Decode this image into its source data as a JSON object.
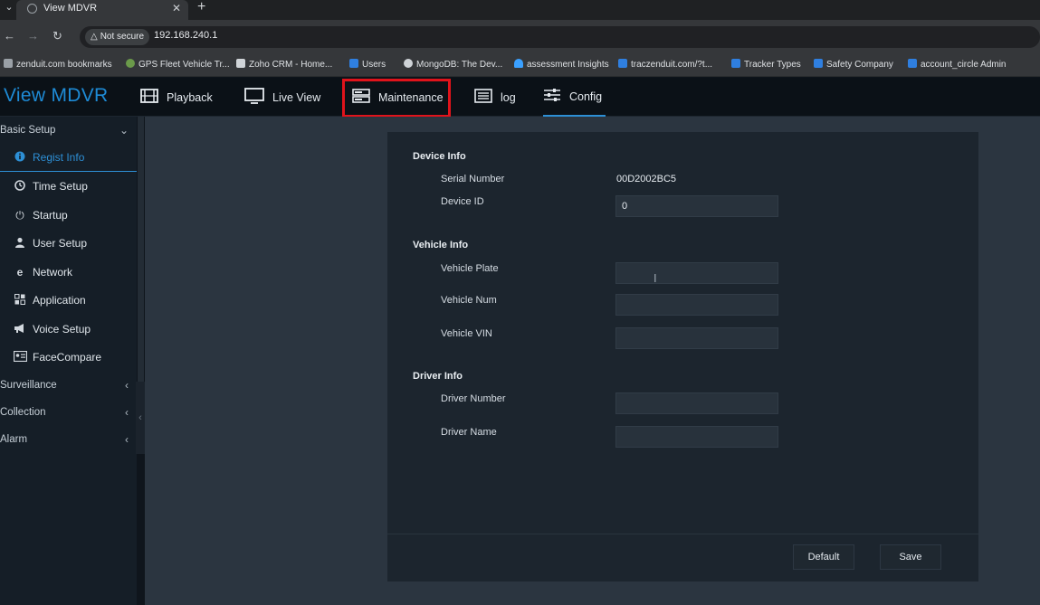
{
  "browser": {
    "tab_title": "View MDVR",
    "security_label": "Not secure",
    "url": "192.168.240.1",
    "bookmarks": [
      {
        "label": "zenduit.com bookmarks",
        "icon": "folder-icon",
        "color": "#9aa0a6"
      },
      {
        "label": "GPS Fleet Vehicle Tr...",
        "icon": "globe-icon",
        "color": "#6b9a4a"
      },
      {
        "label": "Zoho CRM - Home...",
        "icon": "zoho-icon",
        "color": "#d0d4d8"
      },
      {
        "label": "Users",
        "icon": "zenduit-icon",
        "color": "#2f7fe0"
      },
      {
        "label": "MongoDB: The Dev...",
        "icon": "mongodb-icon",
        "color": "#cfd3d7"
      },
      {
        "label": "assessment Insights",
        "icon": "cloud-icon",
        "color": "#3aa0ff"
      },
      {
        "label": "traczenduit.com/?t...",
        "icon": "zenduit-icon",
        "color": "#2f7fe0"
      },
      {
        "label": "Tracker Types",
        "icon": "zenduit-icon",
        "color": "#2f7fe0"
      },
      {
        "label": "Safety Company",
        "icon": "zenduit-icon",
        "color": "#2f7fe0"
      },
      {
        "label": "account_circle Admin",
        "icon": "zenduit-icon",
        "color": "#2f7fe0"
      }
    ]
  },
  "app": {
    "logo": "View MDVR",
    "nav": [
      {
        "label": "Playback",
        "icon": "film-icon"
      },
      {
        "label": "Live View",
        "icon": "monitor-icon"
      },
      {
        "label": "Maintenance",
        "icon": "server-icon"
      },
      {
        "label": "log",
        "icon": "list-icon"
      },
      {
        "label": "Config",
        "icon": "sliders-icon",
        "active": true
      }
    ],
    "accent_color": "#2d8fd5",
    "highlight_color": "#e0131b"
  },
  "sidebar": {
    "groups": [
      {
        "label": "Basic Setup",
        "expanded": true
      },
      {
        "label": "Surveillance",
        "expanded": false
      },
      {
        "label": "Collection",
        "expanded": false
      },
      {
        "label": "Alarm",
        "expanded": false
      }
    ],
    "items": [
      {
        "label": "Regist Info",
        "icon": "info-icon",
        "active": true
      },
      {
        "label": "Time Setup",
        "icon": "clock-icon"
      },
      {
        "label": "Startup",
        "icon": "power-icon"
      },
      {
        "label": "User Setup",
        "icon": "user-icon"
      },
      {
        "label": "Network",
        "icon": "network-icon"
      },
      {
        "label": "Application",
        "icon": "grid-icon"
      },
      {
        "label": "Voice Setup",
        "icon": "megaphone-icon"
      },
      {
        "label": "FaceCompare",
        "icon": "id-card-icon"
      }
    ]
  },
  "form": {
    "device_info": {
      "title": "Device Info",
      "serial_label": "Serial Number",
      "serial_value": "00D2002BC5",
      "device_id_label": "Device ID",
      "device_id_value": "0"
    },
    "vehicle_info": {
      "title": "Vehicle Info",
      "plate_label": "Vehicle Plate",
      "plate_value": "",
      "num_label": "Vehicle Num",
      "num_value": "",
      "vin_label": "Vehicle VIN",
      "vin_value": ""
    },
    "driver_info": {
      "title": "Driver Info",
      "number_label": "Driver Number",
      "number_value": "",
      "name_label": "Driver Name",
      "name_value": ""
    },
    "buttons": {
      "default": "Default",
      "save": "Save"
    }
  }
}
